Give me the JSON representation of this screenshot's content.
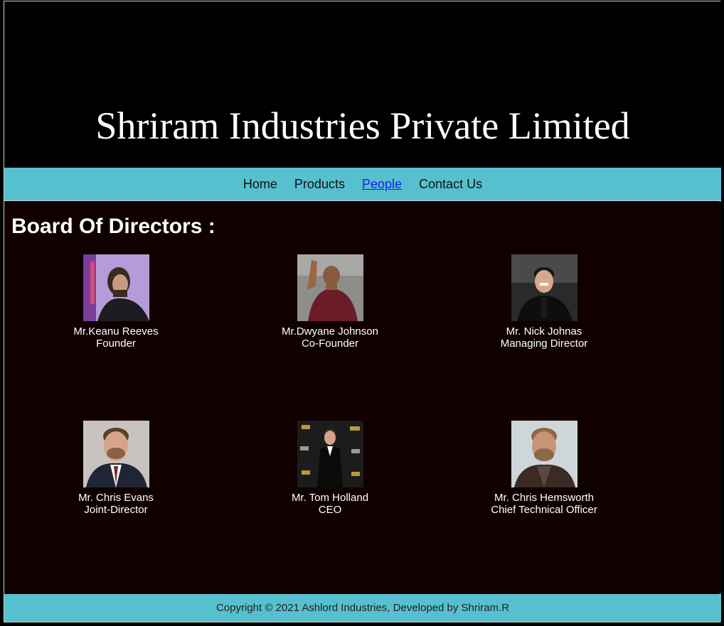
{
  "header": {
    "title": "Shriram Industries Private Limited"
  },
  "nav": {
    "items": [
      {
        "label": "Home"
      },
      {
        "label": "Products"
      },
      {
        "label": "People"
      },
      {
        "label": "Contact Us"
      }
    ],
    "active": "People",
    "active_color": "#1a1aff",
    "bar_color": "#56c0cf"
  },
  "main": {
    "heading": "Board Of Directors :",
    "people": [
      {
        "name": "Mr.Keanu Reeves",
        "role": "Founder",
        "photo": "portrait-keanu-reeves"
      },
      {
        "name": "Mr.Dwyane Johnson",
        "role": "Co-Founder",
        "photo": "portrait-dwyane-johnson"
      },
      {
        "name": "Mr. Nick Johnas",
        "role": "Managing Director",
        "photo": "portrait-nick-jonas"
      },
      {
        "name": "Mr. Chris Evans",
        "role": "Joint-Director",
        "photo": "portrait-chris-evans"
      },
      {
        "name": "Mr. Tom Holland",
        "role": "CEO",
        "photo": "portrait-tom-holland"
      },
      {
        "name": "Mr. Chris Hemsworth",
        "role": "Chief Technical Officer",
        "photo": "portrait-chris-hemsworth"
      }
    ]
  },
  "footer": {
    "text": "Copyright © 2021 Ashlord Industries, Developed by Shriram.R"
  }
}
